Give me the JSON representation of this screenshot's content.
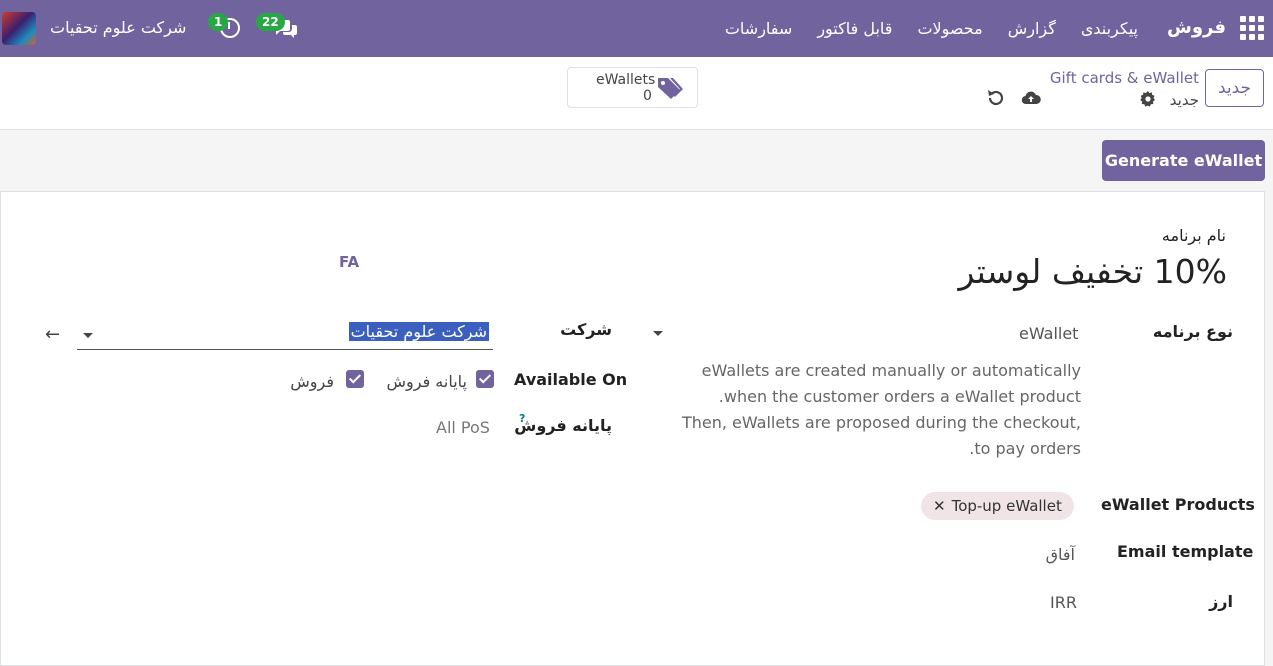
{
  "navbar": {
    "brand": "فروش",
    "menu": [
      "سفارشات",
      "قابل فاکتور",
      "محصولات",
      "گزارش",
      "پیکربندی"
    ],
    "company": "شرکت علوم تحقیات",
    "activity_count": "1",
    "messages_count": "22"
  },
  "control": {
    "new_button": "جدید",
    "breadcrumb": "Gift cards & eWallet",
    "record_title": "جدید",
    "stat": {
      "label": "eWallets",
      "value": "0"
    }
  },
  "actions": {
    "generate_label": "Generate eWallet"
  },
  "form": {
    "program_name_label": "نام برنامه",
    "program_name": "10% تخفیف لوستر",
    "lang": "FA",
    "program_type_label": "نوع برنامه",
    "program_type": "eWallet",
    "description": "eWallets are created manually or automatically when the customer orders a eWallet product.\nThen, eWallets are proposed during the checkout, to pay orders.",
    "company_label": "شرکت",
    "company_value": "شرکت علوم تحقیات",
    "available_on_label": "Available On",
    "available_on_pos": "پایانه فروش",
    "available_on_sales": "فروش",
    "pos_label": "پایانه فروش",
    "pos_help": "?",
    "pos_value": "All PoS",
    "products_label": "eWallet Products",
    "product_tag": "Top-up eWallet",
    "email_label": "Email template",
    "email_value": "آفاق",
    "currency_label": "ارز",
    "currency_value": "IRR"
  },
  "colors": {
    "brand": "#71639e",
    "badge": "#28a745",
    "selection": "#3b5fbe"
  }
}
